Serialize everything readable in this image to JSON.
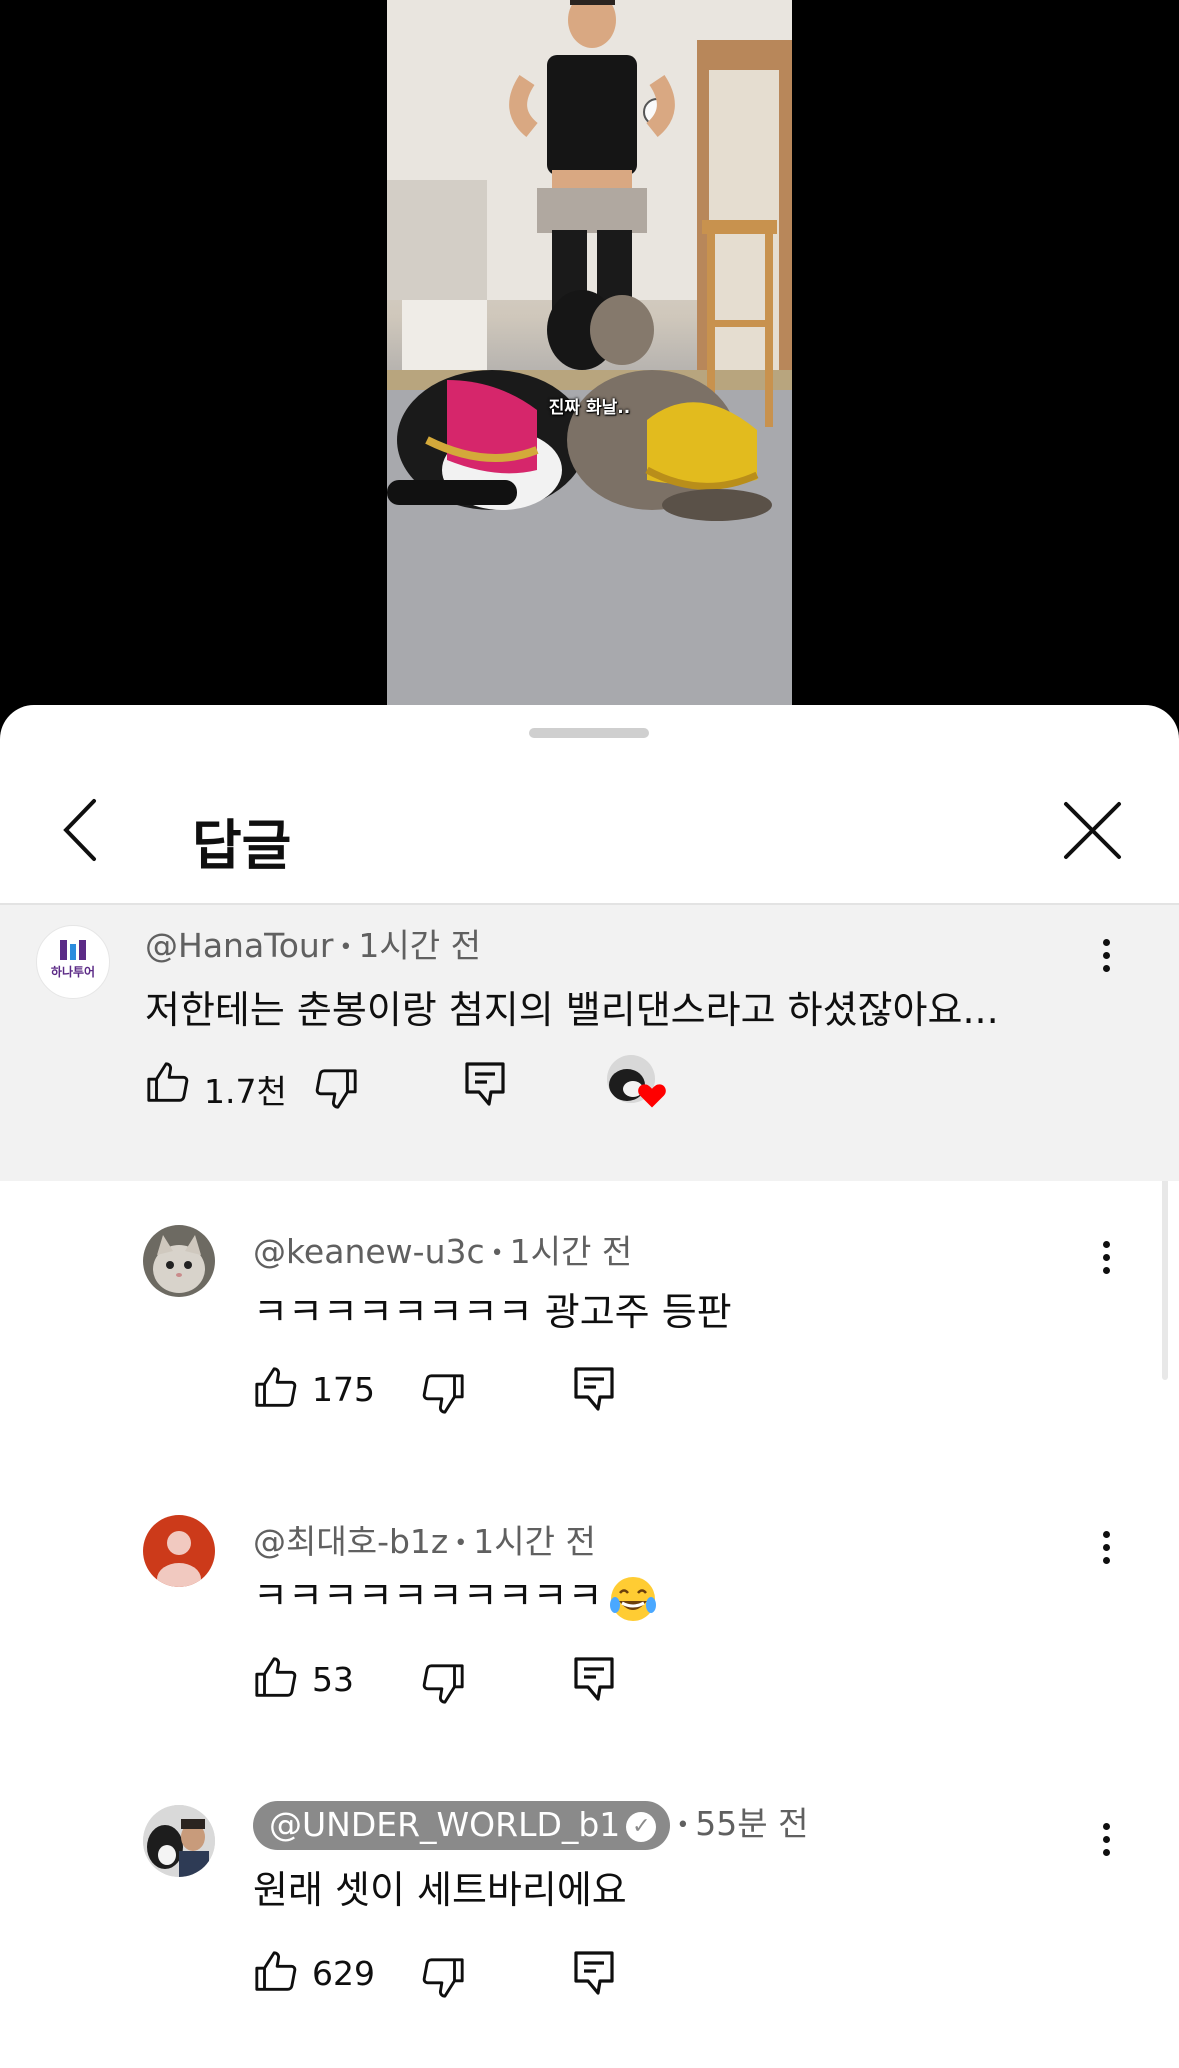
{
  "video": {
    "caption": "진짜 화날.."
  },
  "sheet": {
    "title": "답글"
  },
  "parent_comment": {
    "handle": "@HanaTour",
    "time": "1시간 전",
    "text": "저한테는 춘봉이랑 첨지의 밸리댄스라고 하셨잖아요...",
    "likes": "1.7천",
    "avatar_text": "하나투어",
    "hearted": true
  },
  "replies": [
    {
      "handle": "@keanew-u3c",
      "time": "1시간 전",
      "text": "ㅋㅋㅋㅋㅋㅋㅋㅋ 광고주 등판",
      "likes": "175"
    },
    {
      "handle": "@최대호-b1z",
      "time": "1시간 전",
      "text": "ㅋㅋㅋㅋㅋㅋㅋㅋㅋㅋ",
      "emoji": "face-with-tears-of-joy",
      "likes": "53"
    },
    {
      "handle": "@UNDER_WORLD_b1",
      "time": "55분 전",
      "text": "원래 셋이 세트바리에요",
      "likes": "629",
      "verified_owner": true
    }
  ],
  "colors": {
    "parent_bg": "#f2f2f2",
    "owner_chip": "#8a8a8a",
    "heart": "#ff0000",
    "hana_purple": "#5b2a86",
    "default_avatar": "#cc3a1a"
  },
  "icons": [
    "chevron-left-icon",
    "close-icon",
    "more-vert-icon",
    "thumb-up-icon",
    "thumb-down-icon",
    "reply-icon",
    "verified-check-icon",
    "heart-icon"
  ]
}
